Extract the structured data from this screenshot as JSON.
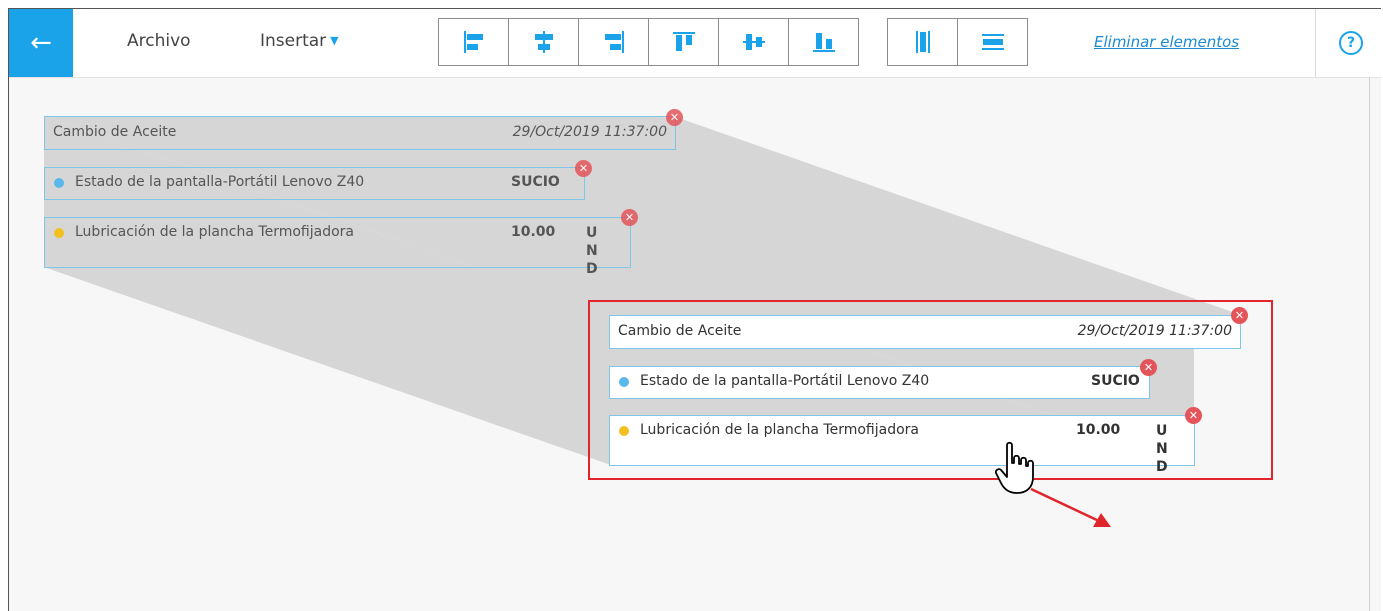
{
  "toolbar": {
    "back_icon": "arrow-left-icon",
    "menu_archivo": "Archivo",
    "menu_insertar": "Insertar",
    "delete_label": "Eliminar elementos",
    "help_label": "?",
    "accent_color": "#1aa3e8",
    "align_tools": [
      "align-left-icon",
      "align-center-horizontal-icon",
      "align-right-icon",
      "align-top-icon",
      "align-middle-vertical-icon",
      "align-bottom-icon"
    ],
    "distribute_tools": [
      "distribute-vertical-icon",
      "distribute-horizontal-icon"
    ]
  },
  "ghost_group": {
    "header_title": "Cambio de Aceite",
    "header_date": "29/Oct/2019 11:37:00",
    "item1_text": "Estado de la pantalla-Portátil Lenovo Z40",
    "item1_value": "SUCIO",
    "item1_dot_color": "#5bb8ea",
    "item2_text": "Lubricación de la plancha Termofijadora",
    "item2_value": "10.00",
    "item2_unit": "UND",
    "item2_dot_color": "#f2c01e"
  },
  "selected_group": {
    "header_title": "Cambio de Aceite",
    "header_date": "29/Oct/2019 11:37:00",
    "item1_text": "Estado de la pantalla-Portátil Lenovo Z40",
    "item1_value": "SUCIO",
    "item1_dot_color": "#5bb8ea",
    "item2_text": "Lubricación de la plancha Termofijadora",
    "item2_value": "10.00",
    "item2_unit": "UND",
    "item2_dot_color": "#f2c01e"
  },
  "close_glyph": "✕",
  "selection_color": "#e0262b"
}
